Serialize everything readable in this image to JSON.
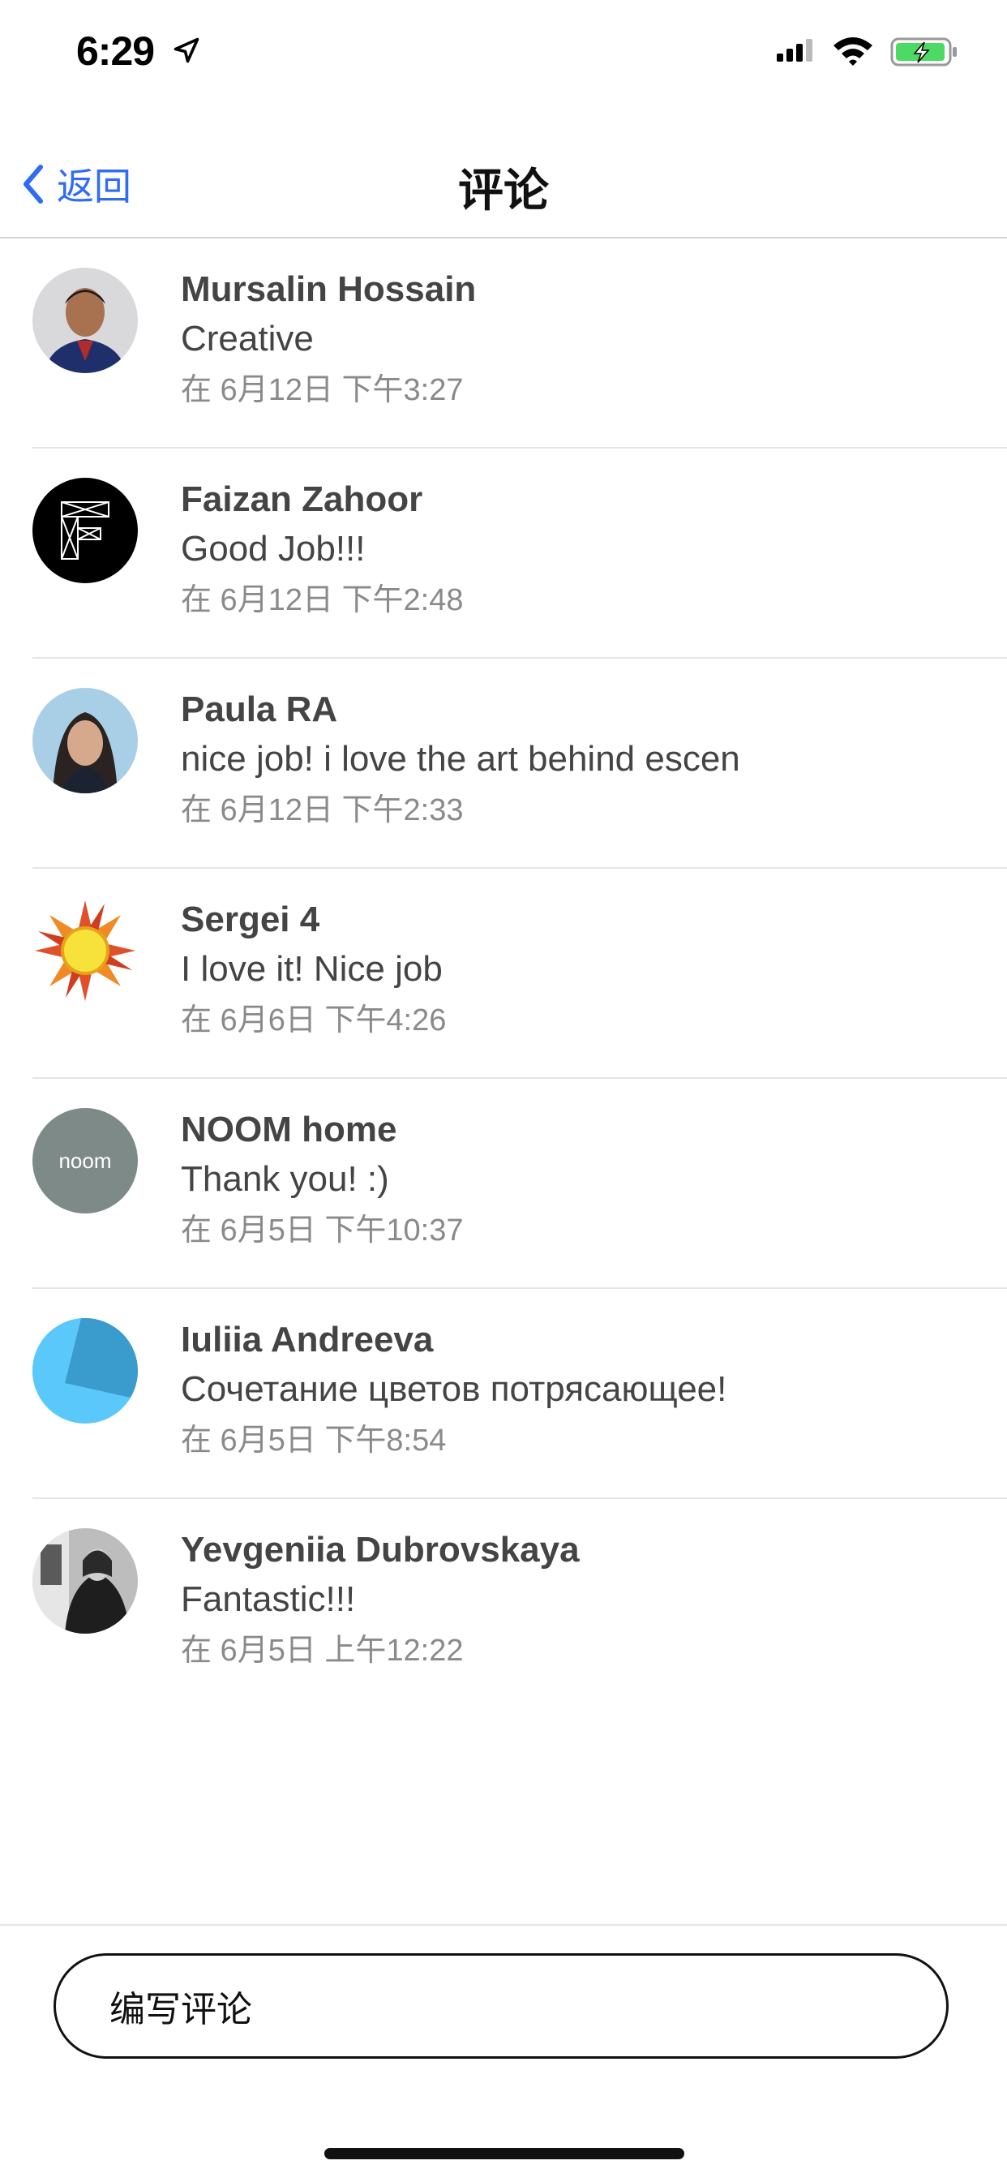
{
  "status_bar": {
    "time": "6:29",
    "icons": [
      "location-arrow-icon",
      "cellular-signal-icon",
      "wifi-icon",
      "battery-charging-icon"
    ],
    "battery_color": "#4cd964"
  },
  "nav": {
    "back_label": "返回",
    "title": "评论",
    "accent_color": "#2f6cf5"
  },
  "comments": [
    {
      "name": "Mursalin Hossain",
      "text": "Creative",
      "time": "在 6月12日 下午3:27"
    },
    {
      "name": "Faizan Zahoor",
      "text": "Good Job!!!",
      "time": "在 6月12日 下午2:48"
    },
    {
      "name": "Paula RA",
      "text": "nice job! i love the art behind escen",
      "time": "在 6月12日 下午2:33"
    },
    {
      "name": "Sergei 4",
      "text": "I love it! Nice job",
      "time": "在 6月6日 下午4:26"
    },
    {
      "name": "NOOM home",
      "text": "Thank you! :)",
      "time": "在 6月5日 下午10:37",
      "avatar_text": "noom"
    },
    {
      "name": "Iuliia Andreeva",
      "text": "Сочетание цветов потрясающее!",
      "time": "在 6月5日 下午8:54"
    },
    {
      "name": "Yevgeniia Dubrovskaya",
      "text": "Fantastic!!!",
      "time": "在 6月5日 上午12:22"
    }
  ],
  "composer": {
    "placeholder": "编写评论"
  }
}
